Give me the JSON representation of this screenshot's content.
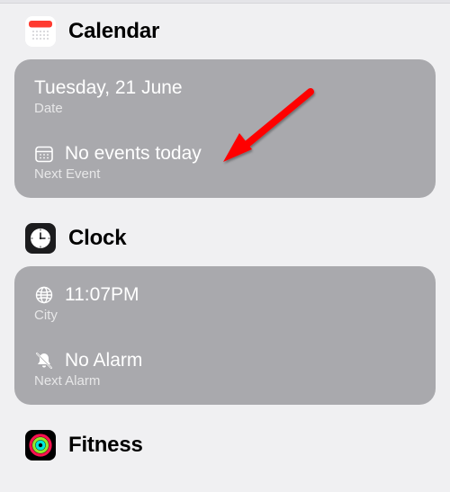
{
  "sections": {
    "calendar": {
      "title": "Calendar",
      "date_line": "Tuesday, 21 June",
      "date_label": "Date",
      "event_line": "No events today",
      "event_label": "Next Event"
    },
    "clock": {
      "title": "Clock",
      "time_line": "11:07PM",
      "time_label": "City",
      "alarm_line": "No Alarm",
      "alarm_label": "Next Alarm"
    },
    "fitness": {
      "title": "Fitness"
    }
  }
}
